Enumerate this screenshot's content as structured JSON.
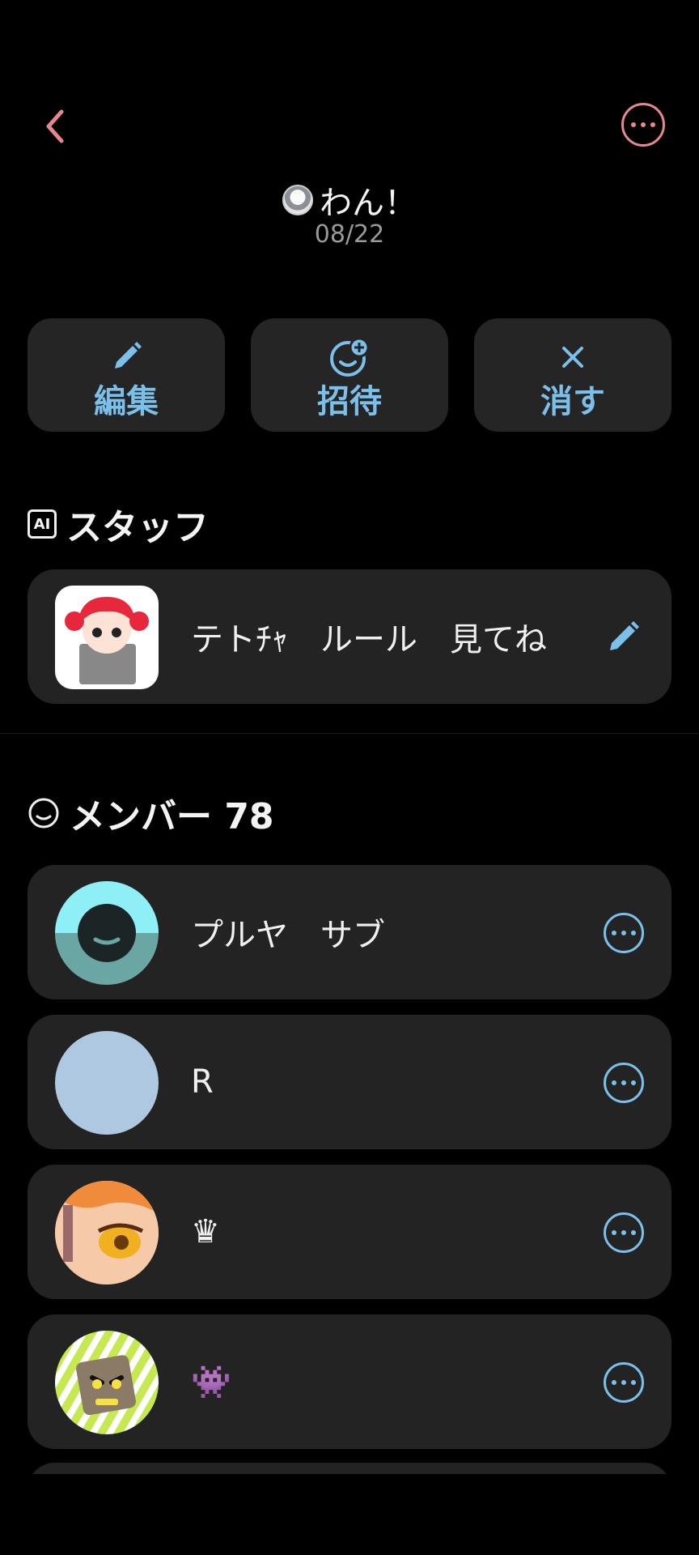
{
  "header": {
    "title": "わん！",
    "date": "08/22",
    "back_icon": "chevron-left-icon",
    "more_icon": "more-horizontal-icon",
    "accent": "#e8878f"
  },
  "actions": [
    {
      "label": "編集",
      "icon": "pencil-icon"
    },
    {
      "label": "招待",
      "icon": "add-face-icon"
    },
    {
      "label": "消す",
      "icon": "close-icon"
    }
  ],
  "action_color": "#7bc0ea",
  "staff": {
    "heading": "スタッフ",
    "badge": "AI",
    "name": "テトﾁｬ　ルール　見てね",
    "edit_icon": "pencil-icon"
  },
  "members": {
    "heading": "メンバー 78",
    "items": [
      {
        "name": "プルヤ　サブ",
        "avatar": "default-face-avatar"
      },
      {
        "name": "R",
        "avatar": "blank-blue-avatar"
      },
      {
        "name": "♛",
        "avatar": "anime-eye-avatar"
      },
      {
        "name": "👾",
        "avatar": "cardboard-cat-avatar"
      }
    ]
  }
}
